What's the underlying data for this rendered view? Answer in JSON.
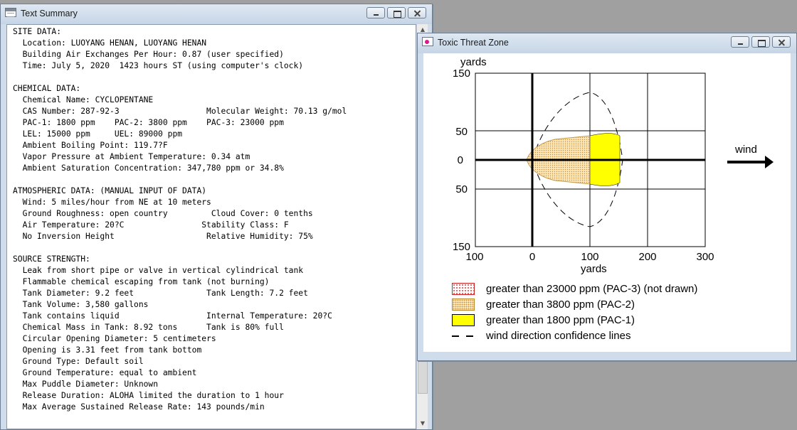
{
  "text_summary": {
    "title": "Text Summary",
    "lines": [
      "SITE DATA:",
      "  Location: LUOYANG HENAN, LUOYANG HENAN",
      "  Building Air Exchanges Per Hour: 0.87 (user specified)",
      "  Time: July 5, 2020  1423 hours ST (using computer's clock)",
      "",
      "CHEMICAL DATA:",
      "  Chemical Name: CYCLOPENTANE",
      "  CAS Number: 287-92-3                  Molecular Weight: 70.13 g/mol",
      "  PAC-1: 1800 ppm    PAC-2: 3800 ppm    PAC-3: 23000 ppm",
      "  LEL: 15000 ppm     UEL: 89000 ppm",
      "  Ambient Boiling Point: 119.7?F",
      "  Vapor Pressure at Ambient Temperature: 0.34 atm",
      "  Ambient Saturation Concentration: 347,780 ppm or 34.8%",
      "",
      "ATMOSPHERIC DATA: (MANUAL INPUT OF DATA)",
      "  Wind: 5 miles/hour from NE at 10 meters",
      "  Ground Roughness: open country         Cloud Cover: 0 tenths",
      "  Air Temperature: 20?C                Stability Class: F",
      "  No Inversion Height                   Relative Humidity: 75%",
      "",
      "SOURCE STRENGTH:",
      "  Leak from short pipe or valve in vertical cylindrical tank",
      "  Flammable chemical escaping from tank (not burning)",
      "  Tank Diameter: 9.2 feet               Tank Length: 7.2 feet",
      "  Tank Volume: 3,580 gallons",
      "  Tank contains liquid                  Internal Temperature: 20?C",
      "  Chemical Mass in Tank: 8.92 tons      Tank is 80% full",
      "  Circular Opening Diameter: 5 centimeters",
      "  Opening is 3.31 feet from tank bottom",
      "  Ground Type: Default soil",
      "  Ground Temperature: equal to ambient",
      "  Max Puddle Diameter: Unknown",
      "  Release Duration: ALOHA limited the duration to 1 hour",
      "  Max Average Sustained Release Rate: 143 pounds/min"
    ]
  },
  "threat_zone": {
    "title": "Toxic Threat Zone",
    "y_axis_label": "yards",
    "x_axis_label": "yards",
    "wind_label": "wind",
    "y_ticks": [
      "150",
      "50",
      "0",
      "50",
      "150"
    ],
    "x_ticks": [
      "100",
      "0",
      "100",
      "200",
      "300"
    ],
    "legend": [
      "greater than 23000 ppm (PAC-3) (not drawn)",
      "greater than 3800 ppm (PAC-2)",
      "greater than 1800 ppm (PAC-1)",
      "wind direction confidence lines"
    ],
    "colors": {
      "pac1": "#ffff00",
      "pac2": "#fbe7b8",
      "pac3": "#e04040"
    }
  }
}
